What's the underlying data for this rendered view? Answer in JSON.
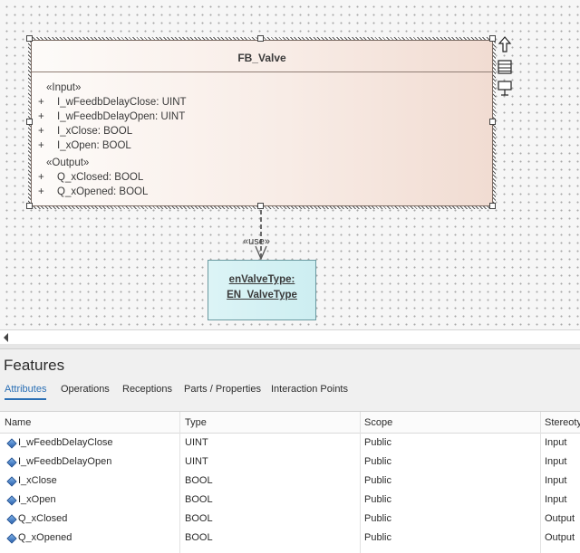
{
  "diagram": {
    "class": {
      "name": "FB_Valve",
      "input_stereotype": "«Input»",
      "output_stereotype": "«Output»",
      "inputs": [
        {
          "visibility": "+",
          "text": "I_wFeedbDelayClose: UINT"
        },
        {
          "visibility": "+",
          "text": "I_wFeedbDelayOpen: UINT"
        },
        {
          "visibility": "+",
          "text": "I_xClose: BOOL"
        },
        {
          "visibility": "+",
          "text": "I_xOpen: BOOL"
        }
      ],
      "outputs": [
        {
          "visibility": "+",
          "text": "Q_xClosed: BOOL"
        },
        {
          "visibility": "+",
          "text": "Q_xOpened: BOOL"
        }
      ]
    },
    "connector_label": "«use»",
    "enum": {
      "line1": "enValveType:",
      "line2": "EN_ValveType"
    }
  },
  "features": {
    "title": "Features",
    "tabs": [
      "Attributes",
      "Operations",
      "Receptions",
      "Parts / Properties",
      "Interaction Points"
    ],
    "active_tab": "Attributes",
    "columns": [
      "Name",
      "Type",
      "Scope",
      "Stereotype"
    ],
    "rows": [
      {
        "name": "I_wFeedbDelayClose",
        "type": "UINT",
        "scope": "Public",
        "stereotype": "Input"
      },
      {
        "name": "I_wFeedbDelayOpen",
        "type": "UINT",
        "scope": "Public",
        "stereotype": "Input"
      },
      {
        "name": "I_xClose",
        "type": "BOOL",
        "scope": "Public",
        "stereotype": "Input"
      },
      {
        "name": "I_xOpen",
        "type": "BOOL",
        "scope": "Public",
        "stereotype": "Input"
      },
      {
        "name": "Q_xClosed",
        "type": "BOOL",
        "scope": "Public",
        "stereotype": "Output"
      },
      {
        "name": "Q_xOpened",
        "type": "BOOL",
        "scope": "Public",
        "stereotype": "Output"
      }
    ]
  },
  "colors": {
    "accent": "#2a6fb5",
    "class_fill": "#f8ece6",
    "enum_fill": "#cdeef1"
  }
}
